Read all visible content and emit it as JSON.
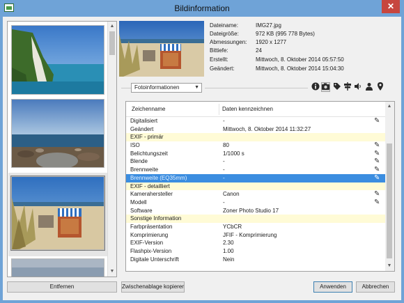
{
  "window": {
    "title": "Bildinformation",
    "close_label": "✕"
  },
  "file_info": [
    {
      "label": "Dateiname:",
      "value": "IMG27.jpg"
    },
    {
      "label": "Dateigröße:",
      "value": "972 KB (995 778 Bytes)"
    },
    {
      "label": "Abmessungen:",
      "value": "1920 x 1277"
    },
    {
      "label": "Bittiefe:",
      "value": "24"
    },
    {
      "label": "Erstellt:",
      "value": "Mittwoch, 8. Oktober 2014 05:57:50"
    },
    {
      "label": "Geändert:",
      "value": "Mittwoch, 8. Oktober 2014 15:04:30"
    }
  ],
  "view_select": {
    "value": "Fotoinformationen"
  },
  "toolbar_icons": [
    "info-icon",
    "camera-icon",
    "tag-icon",
    "sign-icon",
    "speaker-icon",
    "person-icon",
    "location-pin-icon"
  ],
  "table": {
    "headers": [
      "Zeichenname",
      "Daten kennzeichnen"
    ],
    "rows": [
      {
        "name": "Digitalisiert",
        "value": "-",
        "editable": true,
        "type": "normal"
      },
      {
        "name": "Geändert",
        "value": "Mittwoch, 8. Oktober 2014 11:32:27",
        "editable": false,
        "type": "normal"
      },
      {
        "name": "EXIF - primär",
        "value": "",
        "editable": false,
        "type": "section"
      },
      {
        "name": "ISO",
        "value": "80",
        "editable": true,
        "type": "normal"
      },
      {
        "name": "Belichtungszeit",
        "value": "1/1000 s",
        "editable": true,
        "type": "normal"
      },
      {
        "name": "Blende",
        "value": "-",
        "editable": true,
        "type": "normal"
      },
      {
        "name": "Brennweite",
        "value": "-",
        "editable": true,
        "type": "normal"
      },
      {
        "name": "Brennweite (EQ35mm)",
        "value": "-",
        "editable": true,
        "type": "selected"
      },
      {
        "name": "EXIF - detailliert",
        "value": "",
        "editable": false,
        "type": "section"
      },
      {
        "name": "Kamerahersteller",
        "value": "Canon",
        "editable": true,
        "type": "normal"
      },
      {
        "name": "Modell",
        "value": "-",
        "editable": true,
        "type": "normal"
      },
      {
        "name": "Software",
        "value": "Zoner Photo Studio 17",
        "editable": false,
        "type": "normal"
      },
      {
        "name": "Sonstige Information",
        "value": "",
        "editable": false,
        "type": "section"
      },
      {
        "name": "Farbpräsentation",
        "value": "YCbCR",
        "editable": false,
        "type": "normal"
      },
      {
        "name": "Komprimierung",
        "value": "JFIF - Komprimierung",
        "editable": false,
        "type": "normal"
      },
      {
        "name": "EXIF-Version",
        "value": "2.30",
        "editable": false,
        "type": "normal"
      },
      {
        "name": "Flashpix-Version",
        "value": "1.00",
        "editable": false,
        "type": "normal"
      },
      {
        "name": "Digitale Unterschrift",
        "value": "Nein",
        "editable": false,
        "type": "normal"
      }
    ]
  },
  "buttons": {
    "remove": "Entfernen",
    "clipboard": "Zwischenablage kopieren",
    "apply": "Anwenden",
    "cancel": "Abbrechen"
  },
  "colors": {
    "title_bar": "#6fa3d7",
    "selection": "#3b8de0",
    "section_row": "#fffbd6",
    "close_button": "#c7463f"
  }
}
